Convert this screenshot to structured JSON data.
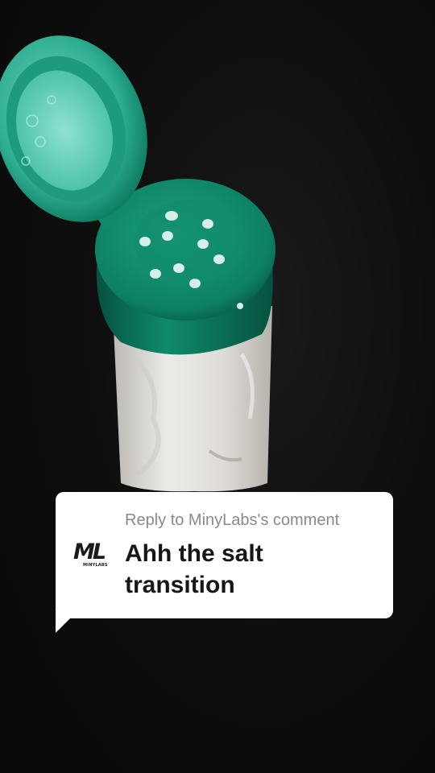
{
  "photo": {
    "subject": "salt-shaker",
    "colors": {
      "background": "#0c0c0c",
      "cap": "#0f8a6a",
      "cap_dark": "#086048",
      "salt": "#e4e1dc"
    }
  },
  "reply": {
    "heading": "Reply to MinyLabs's comment",
    "avatar_logo": "ML",
    "avatar_sub": "MINYLABS",
    "comment": "Ahh the salt transition"
  }
}
